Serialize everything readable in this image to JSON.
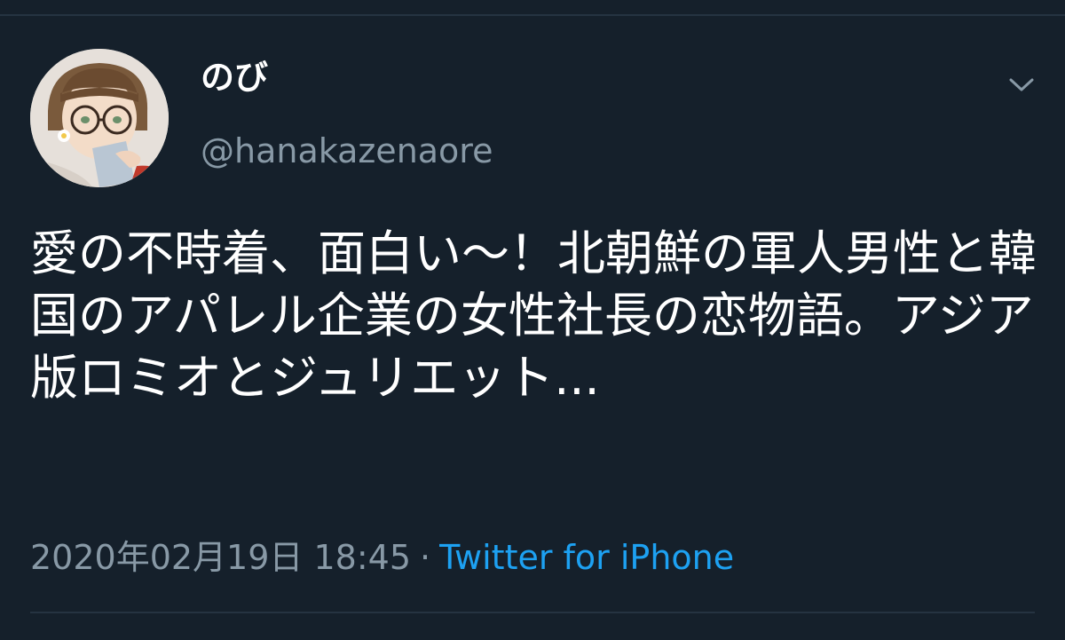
{
  "tweet": {
    "author": {
      "display_name": "のび",
      "handle": "@hanakazenaore"
    },
    "text": "愛の不時着、面白い〜！北朝鮮の軍人男性と韓国のアパレル企業の女性社長の恋物語。アジア版ロミオとジュリエット...",
    "timestamp": "2020年02月19日 18:45",
    "separator": "·",
    "source": "Twitter for iPhone"
  },
  "icons": {
    "menu": "chevron-down-icon",
    "avatar": "avatar-illustration"
  },
  "colors": {
    "background": "#15202b",
    "divider": "#253341",
    "text_primary": "#ffffff",
    "text_secondary": "#8899a6",
    "link": "#1da1f2"
  }
}
